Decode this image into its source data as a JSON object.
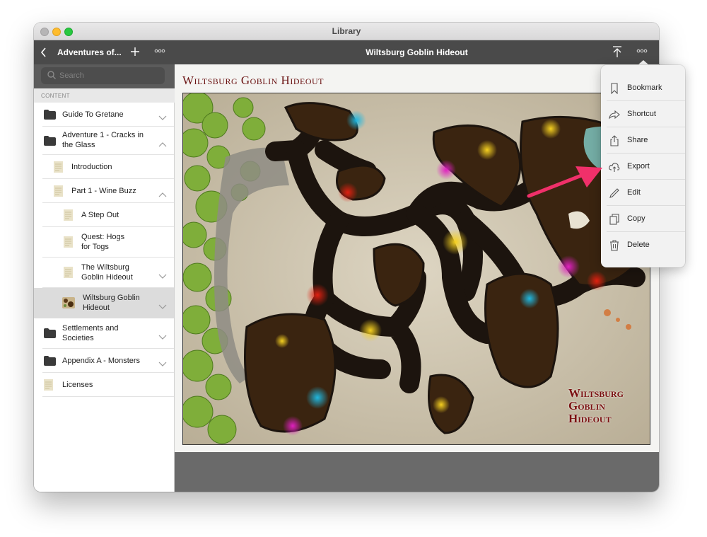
{
  "window": {
    "title": "Library"
  },
  "sidebar": {
    "title": "Adventures of...",
    "search_placeholder": "Search",
    "section_label": "CONTENT",
    "items": [
      {
        "label": "Guide To Gretane",
        "icon": "folder-icon",
        "expanded": false
      },
      {
        "label": "Adventure 1 - Cracks in the Glass",
        "icon": "folder-icon",
        "expanded": true
      },
      {
        "label": "Introduction",
        "icon": "document-icon"
      },
      {
        "label": "Part 1 - Wine Buzz",
        "icon": "document-icon",
        "expanded": true
      },
      {
        "label": "A Step Out",
        "icon": "document-icon"
      },
      {
        "label": "Quest: Hogs for Togs",
        "icon": "document-icon"
      },
      {
        "label": "The Wiltsburg Goblin Hideout",
        "icon": "document-icon",
        "expanded": false
      },
      {
        "label": "Wiltsburg Goblin Hideout",
        "icon": "map-thumbnail-icon",
        "selected": true,
        "expanded": false
      },
      {
        "label": "Settlements and Societies",
        "icon": "folder-icon",
        "expanded": false
      },
      {
        "label": "Appendix A - Monsters",
        "icon": "folder-icon",
        "expanded": false
      },
      {
        "label": "Licenses",
        "icon": "document-icon"
      }
    ]
  },
  "content": {
    "title": "Wiltsburg Goblin Hideout",
    "page_heading": "Wiltsburg Goblin Hideout",
    "map_caption": [
      "Wiltsburg",
      "Goblin",
      "Hideout"
    ]
  },
  "menu": {
    "items": [
      {
        "label": "Bookmark",
        "icon": "bookmark-icon"
      },
      {
        "label": "Shortcut",
        "icon": "shortcut-arrow-icon"
      },
      {
        "label": "Share",
        "icon": "share-icon"
      },
      {
        "label": "Export",
        "icon": "cloud-upload-icon"
      },
      {
        "label": "Edit",
        "icon": "pencil-icon"
      },
      {
        "label": "Copy",
        "icon": "copy-icon"
      },
      {
        "label": "Delete",
        "icon": "trash-icon"
      }
    ]
  },
  "colors": {
    "nav_bar": "#4a4a4a",
    "heading_red": "#6b1414",
    "annotation_arrow": "#f0306a",
    "selected_row": "#dcdcdc"
  }
}
